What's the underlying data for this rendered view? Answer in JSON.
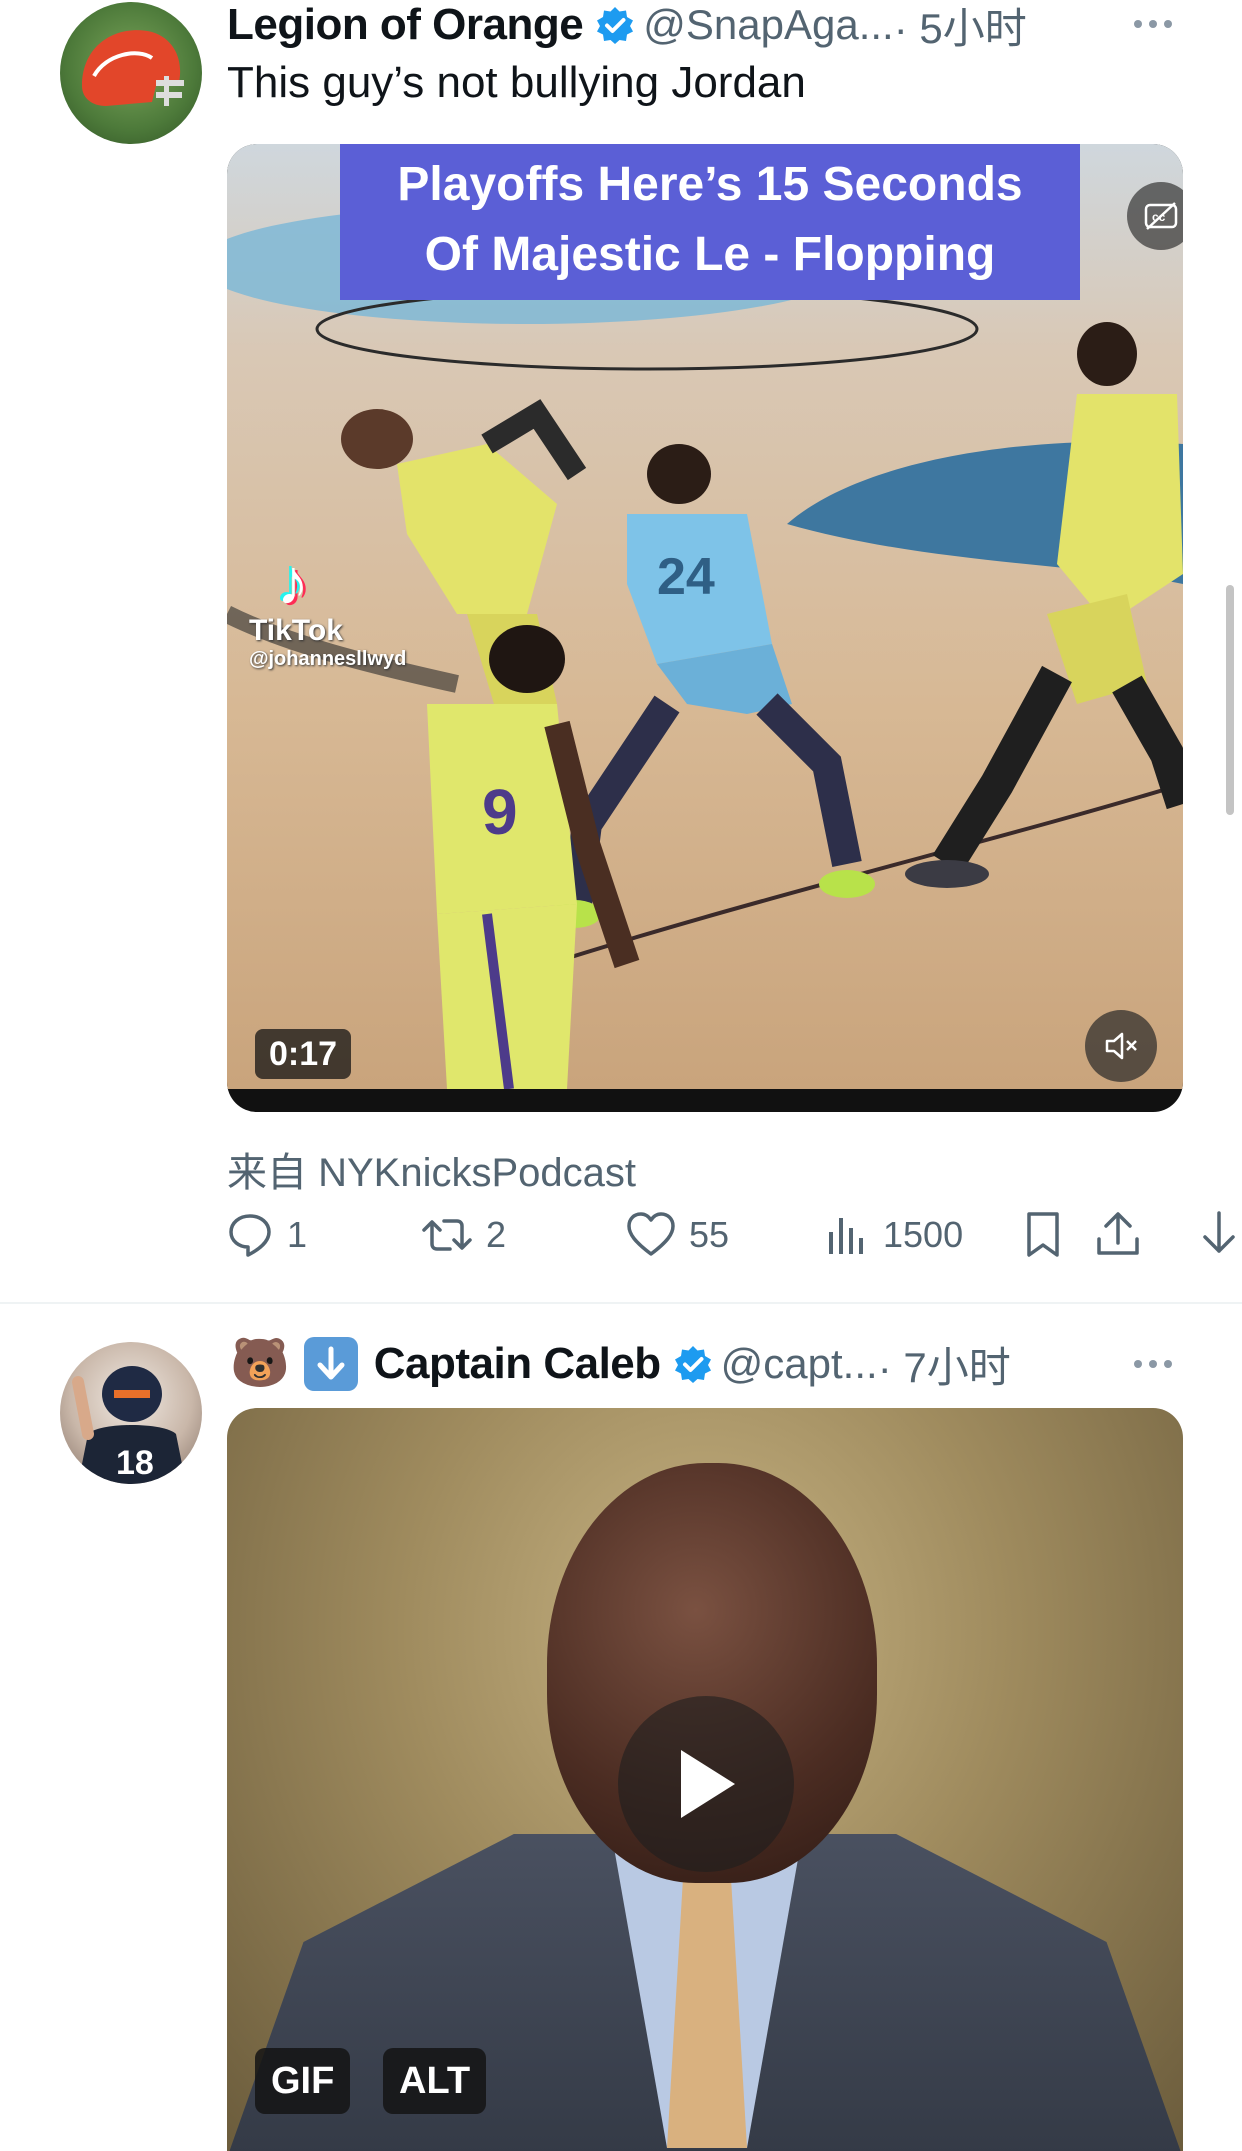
{
  "tweets": [
    {
      "display_name": "Legion of Orange",
      "handle": "@SnapAga...",
      "time": "· 5小时",
      "text": "This guy’s not bullying Jordan",
      "avatar_icon": "football-helmet-icon",
      "media": {
        "banner_line1": "Playoffs Here’s 15 Seconds",
        "banner_line2": "Of Majestic Le - Flopping",
        "watermark_name": "TikTok",
        "watermark_user": "@johannesllwyd",
        "duration": "0:17",
        "cc_label": "cc"
      },
      "source": "来自 NYKnicksPodcast",
      "stats": {
        "replies": "1",
        "reposts": "2",
        "likes": "55",
        "views": "1500"
      }
    },
    {
      "emoji_prefix": "🐻",
      "display_name": "Captain Caleb",
      "handle": "@capt...",
      "time": "· 7小时",
      "avatar_icon": "football-player-icon",
      "media": {
        "gif_tag": "GIF",
        "alt_tag": "ALT"
      }
    }
  ],
  "colors": {
    "verified": "#1d9bf0",
    "secondary_text": "#536471",
    "banner": "#5b5fd6"
  }
}
